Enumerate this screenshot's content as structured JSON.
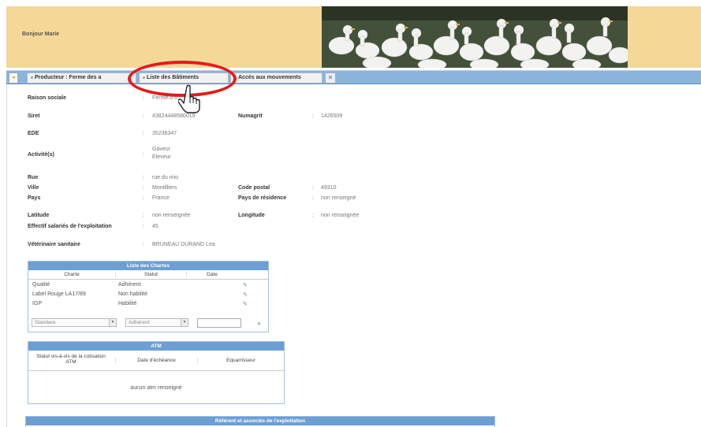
{
  "header": {
    "greeting": "Bonjour Marie"
  },
  "tabs": [
    {
      "label": "Producteur : Ferme des a"
    },
    {
      "label": "Liste des Bâtiments"
    },
    {
      "label": "Accès aux mouvements"
    }
  ],
  "icons": {
    "nav_left": "arrow-left-icon",
    "nav_right": "close-icon",
    "cursor": "hand-pointer-icon",
    "edit": "pencil-icon",
    "add": "plus-icon"
  },
  "colors": {
    "header_bg": "#f4d898",
    "tabbar": "#8bb4dc",
    "panel_title": "#6d9fd4",
    "highlight": "#e41b1b"
  },
  "fields": {
    "raison_sociale": {
      "label": "Raison sociale",
      "value": "Ferme d    s"
    },
    "siret": {
      "label": "Siret",
      "value": "43824448580019"
    },
    "numagrit": {
      "label": "Numagrit",
      "value": "1426509"
    },
    "ede": {
      "label": "EDE",
      "value": "35236347"
    },
    "activites": {
      "label": "Activité(s)",
      "values": [
        "Gaveur",
        "Eleveur"
      ]
    },
    "rue": {
      "label": "Rue",
      "value": "rue du mio"
    },
    "ville": {
      "label": "Ville",
      "value": "Montilliers"
    },
    "code_postal": {
      "label": "Code postal",
      "value": "49310"
    },
    "pays": {
      "label": "Pays",
      "value": "France"
    },
    "pays_residence": {
      "label": "Pays de résidence",
      "value": "non renseigné"
    },
    "latitude": {
      "label": "Latitude",
      "value": "non renseignée"
    },
    "longitude": {
      "label": "Longitude",
      "value": "non renseignée"
    },
    "effectif": {
      "label": "Effectif salariés de l'exploitation",
      "value": "45"
    },
    "veterinaire": {
      "label": "Vétérinaire sanitaire",
      "value": "BRUNEAU DURAND Lea"
    }
  },
  "chartes": {
    "title": "Liste des Chartes",
    "columns": [
      "Charte",
      "Statut",
      "Date"
    ],
    "rows": [
      {
        "charte": "Qualité",
        "statut": "Adhérent"
      },
      {
        "charte": "Label Rouge LA17/89",
        "statut": "Non habilité"
      },
      {
        "charte": "IGP",
        "statut": "Habilité"
      }
    ],
    "new_row": {
      "charte": "Standare",
      "statut": "Adhérent",
      "date": ""
    }
  },
  "atm": {
    "title": "ATM",
    "columns": [
      "Statut vis-à-vis de la cotisation ATM",
      "Date d'échéance",
      "Equarrisseur"
    ],
    "empty": "aucun atm renseigné"
  },
  "referent": {
    "title": "Référent et associés de l'exploitation"
  }
}
